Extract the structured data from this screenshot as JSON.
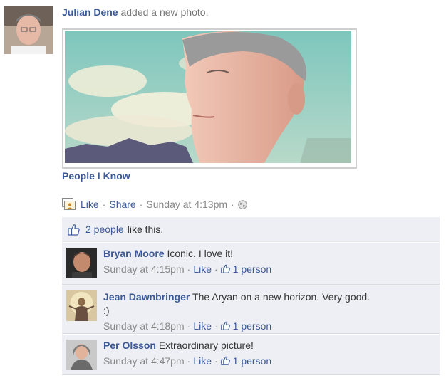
{
  "post": {
    "author": "Julian Dene",
    "action_text": "added a new photo.",
    "album": "People I Know",
    "actions": {
      "like": "Like",
      "share": "Share",
      "separator": "·",
      "timestamp": "Sunday at 4:13pm"
    },
    "photo_alt": "Profile photo of a man against a sky background"
  },
  "feedback": {
    "likes_count_link": "2 people",
    "likes_suffix": "like this."
  },
  "comments": [
    {
      "author": "Bryan Moore",
      "text": "Iconic. I love it!",
      "time": "Sunday at 4:15pm",
      "like": "Like",
      "likes": "1 person"
    },
    {
      "author": "Jean Dawnbringer",
      "text": "The Aryan on a new horizon. Very good.",
      "text2": ":)",
      "time": "Sunday at 4:18pm",
      "like": "Like",
      "likes": "1 person"
    },
    {
      "author": "Per Olsson",
      "text": "Extraordinary picture!",
      "time": "Sunday at 4:47pm",
      "like": "Like",
      "likes": "1 person"
    }
  ],
  "colors": {
    "link": "#3b5998",
    "muted": "#888888",
    "feedback_bg": "#edeff4"
  },
  "icons": [
    "photo-icon",
    "globe-icon",
    "thumbs-up-icon"
  ]
}
